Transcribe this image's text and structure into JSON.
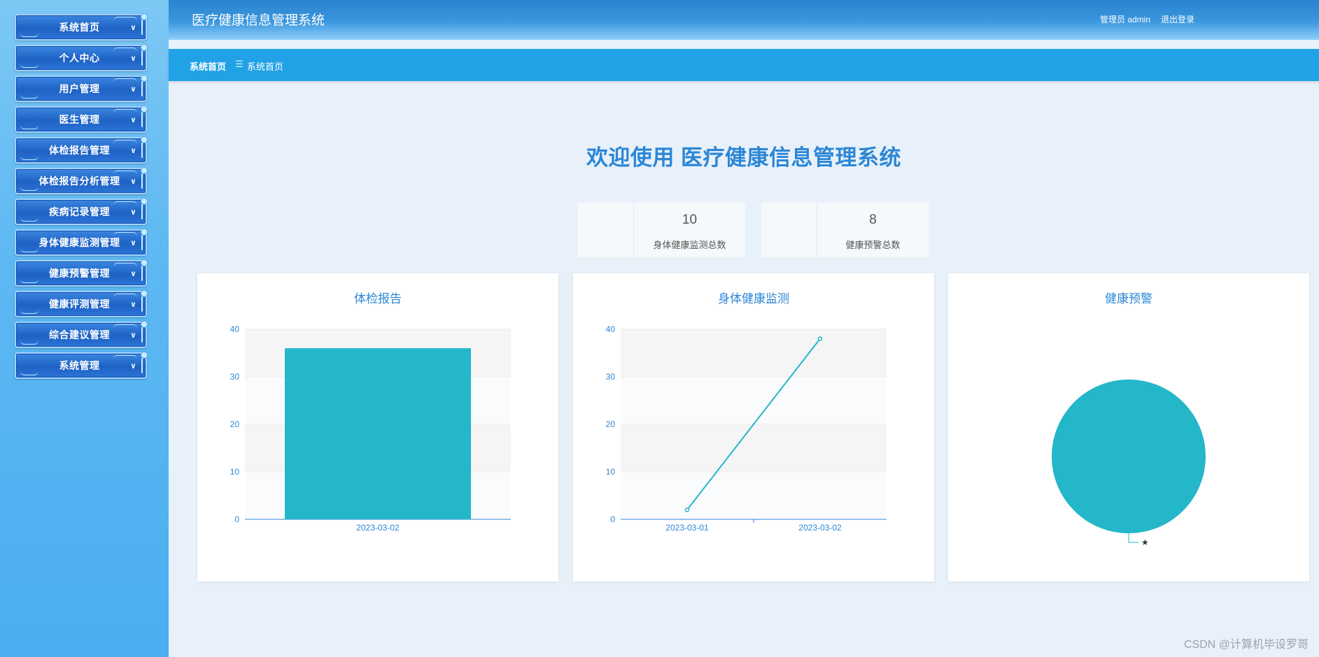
{
  "sidebar": {
    "items": [
      {
        "label": "系统首页"
      },
      {
        "label": "个人中心"
      },
      {
        "label": "用户管理"
      },
      {
        "label": "医生管理"
      },
      {
        "label": "体检报告管理"
      },
      {
        "label": "体检报告分析管理"
      },
      {
        "label": "疾病记录管理"
      },
      {
        "label": "身体健康监测管理"
      },
      {
        "label": "健康预警管理"
      },
      {
        "label": "健康评测管理"
      },
      {
        "label": "综合建议管理"
      },
      {
        "label": "系统管理"
      }
    ]
  },
  "header": {
    "title": "医疗健康信息管理系统",
    "user": "管理员 admin",
    "logout": "退出登录"
  },
  "breadcrumb": {
    "home": "系统首页",
    "separator": "☰",
    "current": "系统首页"
  },
  "welcome": "欢迎使用 医疗健康信息管理系统",
  "stats": [
    {
      "value": "10",
      "label": "身体健康监测总数"
    },
    {
      "value": "8",
      "label": "健康预警总数"
    }
  ],
  "colors": {
    "accent": "#2c86d6",
    "series": "#23b7c9",
    "crumb_bar": "#22a2e6"
  },
  "chart_data": [
    {
      "type": "bar",
      "title": "体检报告",
      "categories": [
        "2023-03-02"
      ],
      "values": [
        36
      ],
      "ylim": [
        0,
        40
      ],
      "yticks": [
        0,
        10,
        20,
        30,
        40
      ]
    },
    {
      "type": "line",
      "title": "身体健康监测",
      "categories": [
        "2023-03-01",
        "2023-03-02"
      ],
      "values": [
        2,
        38
      ],
      "ylim": [
        0,
        40
      ],
      "yticks": [
        0,
        10,
        20,
        30,
        40
      ]
    },
    {
      "type": "pie",
      "title": "健康预警",
      "slices": [
        {
          "label": "★",
          "value": 1
        }
      ]
    }
  ],
  "watermark": "CSDN @计算机毕设罗哥"
}
